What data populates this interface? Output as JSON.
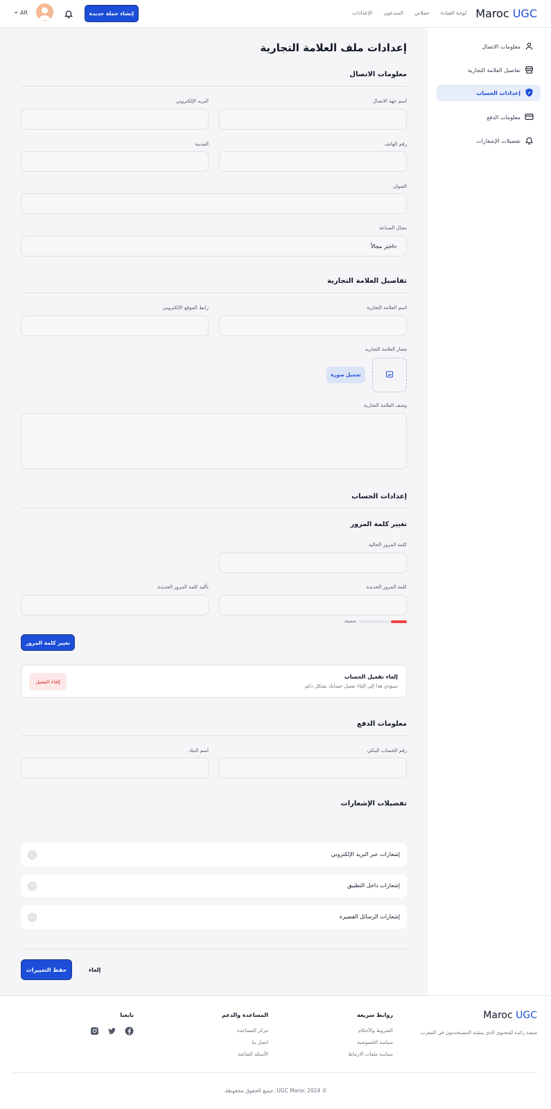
{
  "header": {
    "brand_main": "Maroc",
    "brand_accent": "UGC",
    "nav": [
      "لوحة القيادة",
      "حملاتي",
      "المبدعون",
      "الإعدادات"
    ],
    "create_button": "إنشاء حملة جديدة",
    "language": "AR"
  },
  "sidebar": {
    "items": [
      {
        "label": "معلومات الاتصال",
        "icon": "user-icon"
      },
      {
        "label": "تفاصيل العلامة التجارية",
        "icon": "store-icon"
      },
      {
        "label": "إعدادات الحساب",
        "icon": "shield-icon",
        "active": true
      },
      {
        "label": "معلومات الدفع",
        "icon": "credit-card-icon"
      },
      {
        "label": "تفضيلات الإشعارات",
        "icon": "bell-icon"
      }
    ]
  },
  "page": {
    "title": "إعدادات ملف العلامة التجارية",
    "contact": {
      "title": "معلومات الاتصال",
      "contact_name_label": "اسم جهة الاتصال",
      "email_label": "البريد الإلكتروني",
      "phone_label": "رقم الهاتف",
      "city_label": "المدينة",
      "address_label": "العنوان",
      "industry_label": "مجال الصناعة",
      "industry_placeholder": "اختر مجالاً"
    },
    "brand": {
      "title": "تفاصيل العلامة التجارية",
      "name_label": "اسم العلامة التجارية",
      "website_label": "رابط الموقع الإلكتروني",
      "logo_label": "شعار العلامة التجارية",
      "upload_button": "تحميل صورة",
      "description_label": "وصف العلامة التجارية"
    },
    "account": {
      "title": "إعدادات الحساب",
      "password_title": "تغيير كلمة المرور",
      "current_password_label": "كلمة المرور الحالية",
      "new_password_label": "كلمة المرور الجديدة",
      "confirm_password_label": "تأكيد كلمة المرور الجديدة",
      "strength_text": "ضعيفة",
      "strength_level": 0.33,
      "change_password_button": "تغيير كلمة المرور",
      "deactivate_title": "إلغاء تفعيل الحساب",
      "deactivate_desc": "سيؤدي هذا إلى إلغاء تفعيل حسابك بشكل دائم.",
      "deactivate_button": "إلغاء التفعيل"
    },
    "payment": {
      "title": "معلومات الدفع",
      "account_number_label": "رقم الحساب البنكي",
      "bank_name_label": "اسم البنك"
    },
    "notifications": {
      "title": "تفضيلات الإشعارات",
      "items": [
        "إشعارات عبر البريد الإلكتروني",
        "إشعارات داخل التطبيق",
        "إشعارات الرسائل القصيرة"
      ]
    },
    "actions": {
      "save": "حفظ التغييرات",
      "cancel": "إلغاء"
    }
  },
  "footer": {
    "brand_main": "Maroc",
    "brand_accent": "UGC",
    "tagline": "منصة رائدة للمحتوى الذي ينشئه المستخدمون في المغرب",
    "quick_links_title": "روابط سريعة",
    "quick_links": [
      "الشروط والأحكام",
      "سياسة الخصوصية",
      "سياسة ملفات الارتباط"
    ],
    "support_title": "المساعدة والدعم",
    "support_links": [
      "مركز المساعدة",
      "اتصل بنا",
      "الأسئلة الشائعة"
    ],
    "follow_title": "تابعنا",
    "copyright": "© 2024 UGC Maroc. جميع الحقوق محفوظة."
  },
  "colors": {
    "primary": "#1d4ed8",
    "danger": "#dc2626",
    "background": "#f5f5f7"
  }
}
